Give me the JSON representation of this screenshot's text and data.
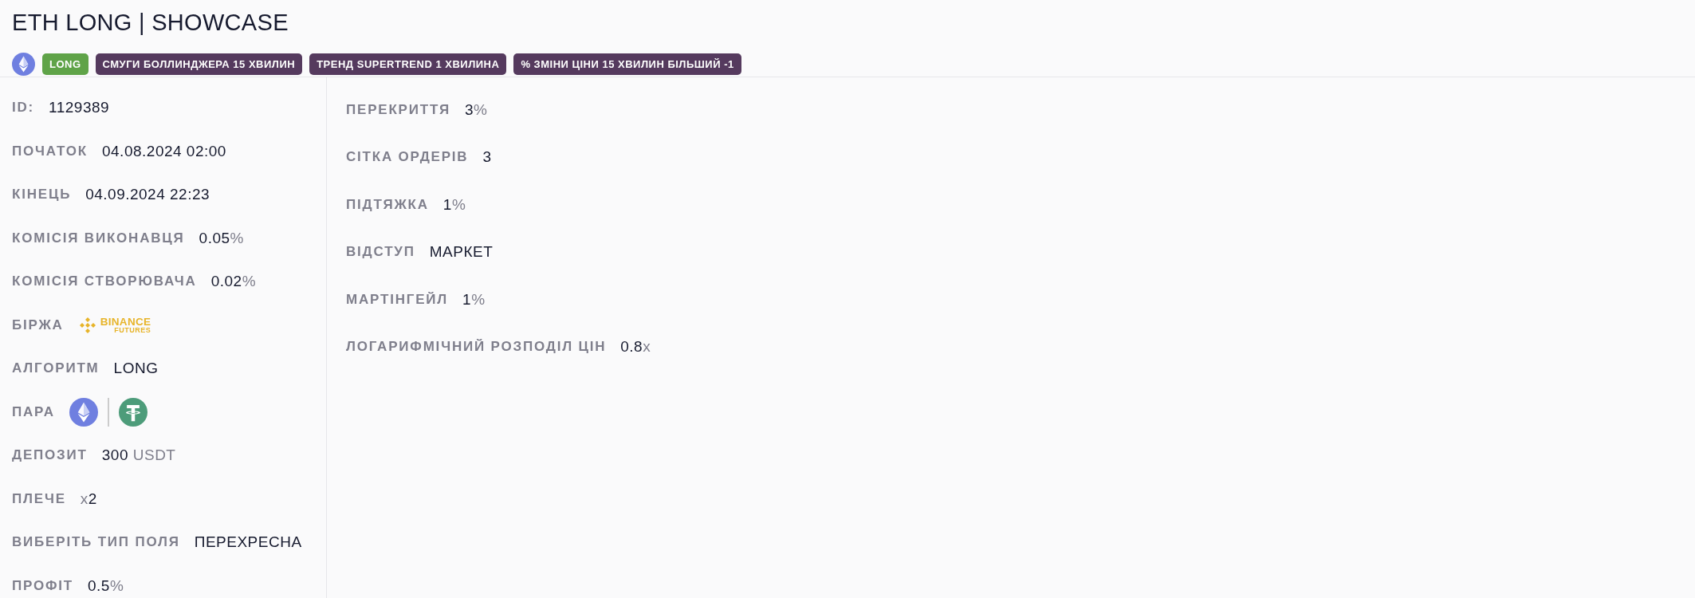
{
  "header": {
    "title": "ETH LONG | SHOWCASE",
    "tags": [
      {
        "kind": "coin-icon"
      },
      {
        "kind": "tag",
        "label": "LONG",
        "color": "#5fa348"
      },
      {
        "kind": "tag",
        "label": "СМУГИ БОЛЛИНДЖЕРА 15 ХВИЛИН",
        "color": "#553a5e"
      },
      {
        "kind": "tag",
        "label": "ТРЕНД SUPERTREND 1 ХВИЛИНА",
        "color": "#553a5e"
      },
      {
        "kind": "tag",
        "label": "% ЗМІНИ ЦІНИ 15 ХВИЛИН БІЛЬШИЙ -1",
        "color": "#553a5e"
      }
    ]
  },
  "left_panel": {
    "rows": [
      {
        "kind": "text",
        "label": "ID:",
        "value": "1129389"
      },
      {
        "kind": "text",
        "label": "ПОЧАТОК",
        "value": "04.08.2024 02:00"
      },
      {
        "kind": "text",
        "label": "КІНЕЦЬ",
        "value": "04.09.2024 22:23"
      },
      {
        "kind": "text",
        "label": "КОМІСІЯ ВИКОНАВЦЯ",
        "value": "0.05",
        "suffix": "%"
      },
      {
        "kind": "text",
        "label": "КОМІСІЯ СТВОРЮВАЧА",
        "value": "0.02",
        "suffix": "%"
      },
      {
        "kind": "exchange",
        "label": "БІРЖА",
        "logo_text": "BINANCE",
        "logo_subtext": "FUTURES"
      },
      {
        "kind": "text",
        "label": "АЛГОРИТМ",
        "value": "LONG"
      },
      {
        "kind": "pair",
        "label": "ПАРА"
      },
      {
        "kind": "text",
        "label": "ДЕПОЗИТ",
        "value": "300",
        "suffix": "USDT",
        "suffix_gap": true
      },
      {
        "kind": "text",
        "label": "ПЛЕЧЕ",
        "prefix": "x",
        "value": "2"
      },
      {
        "kind": "text",
        "label": "ВИБЕРІТЬ ТИП ПОЛЯ",
        "value": "ПЕРЕХРЕСНА"
      },
      {
        "kind": "text",
        "label": "ПРОФІТ",
        "value": "0.5",
        "suffix": "%"
      }
    ]
  },
  "right_panel": {
    "rows": [
      {
        "kind": "text",
        "label": "ПЕРЕКРИТТЯ",
        "value": "3",
        "suffix": "%"
      },
      {
        "kind": "text",
        "label": "СІТКА ОРДЕРІВ",
        "value": "3"
      },
      {
        "kind": "text",
        "label": "ПІДТЯЖКА",
        "value": "1",
        "suffix": "%"
      },
      {
        "kind": "text",
        "label": "ВІДСТУП",
        "value": "МАРКЕТ"
      },
      {
        "kind": "text",
        "label": "МАРТІНГЕЙЛ",
        "value": "1",
        "suffix": "%"
      },
      {
        "kind": "text",
        "label": "ЛОГАРИФМІЧНИЙ РОЗПОДІЛ ЦІН",
        "value": "0.8",
        "suffix": "x"
      }
    ]
  }
}
